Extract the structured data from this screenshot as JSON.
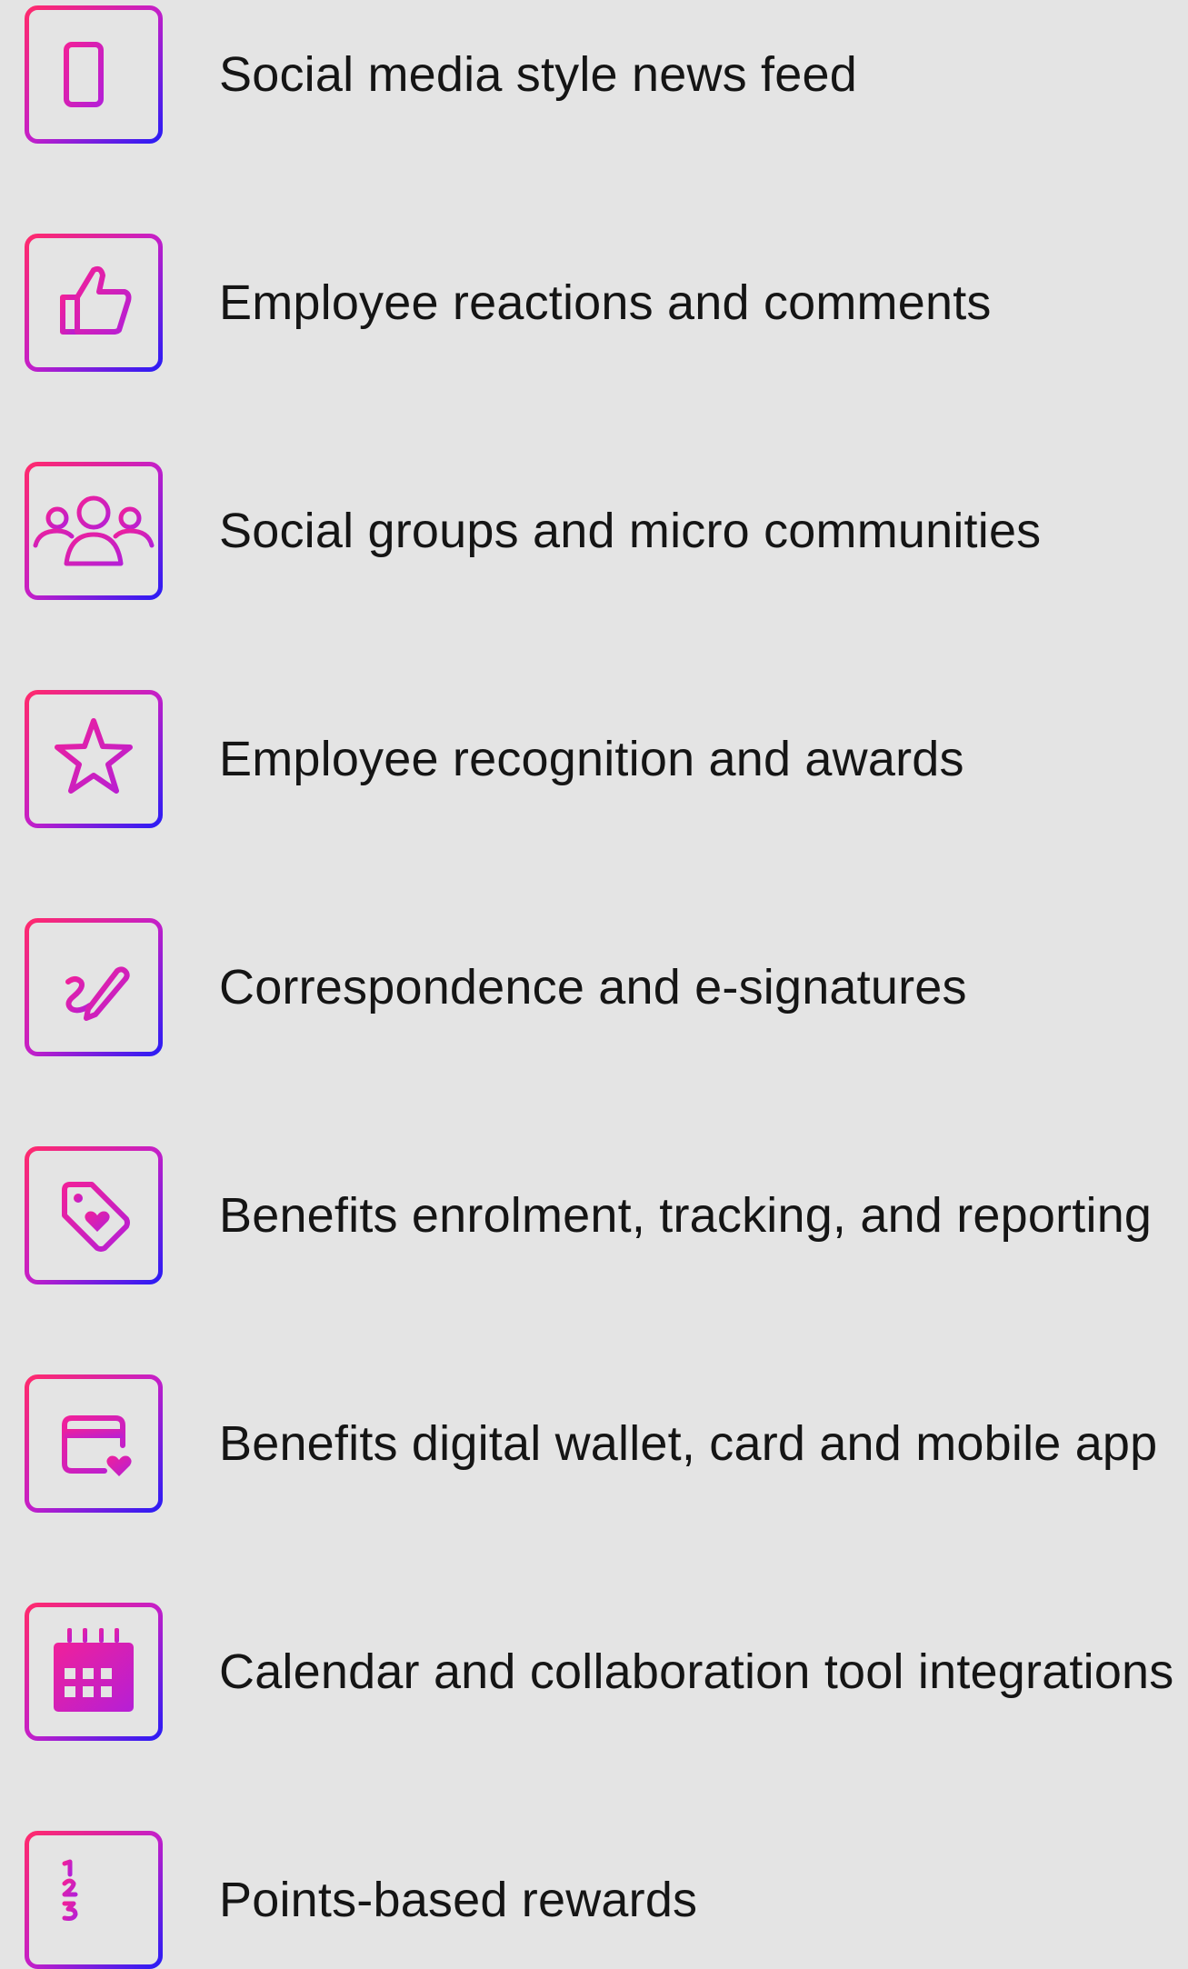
{
  "colors": {
    "background": "#e4e4e4",
    "gradient_start": "#ff2a6d",
    "gradient_mid": "#c41fc8",
    "gradient_end": "#2a1cf5",
    "icon_fill": "#d81fb0",
    "text": "#151515"
  },
  "features": [
    {
      "label": "Social media style news feed",
      "icon": "news-feed-icon"
    },
    {
      "label": "Employee reactions and comments",
      "icon": "thumbs-up-icon"
    },
    {
      "label": "Social groups and micro communities",
      "icon": "group-icon"
    },
    {
      "label": "Employee recognition and awards",
      "icon": "star-icon"
    },
    {
      "label": "Correspondence and e-signatures",
      "icon": "signature-pen-icon"
    },
    {
      "label": "Benefits enrolment, tracking, and reporting",
      "icon": "heart-tag-icon"
    },
    {
      "label": "Benefits digital wallet, card and mobile app",
      "icon": "heart-card-icon"
    },
    {
      "label": "Calendar and collaboration tool integrations",
      "icon": "calendar-icon"
    },
    {
      "label": "Points-based rewards",
      "icon": "numbered-list-icon"
    }
  ]
}
